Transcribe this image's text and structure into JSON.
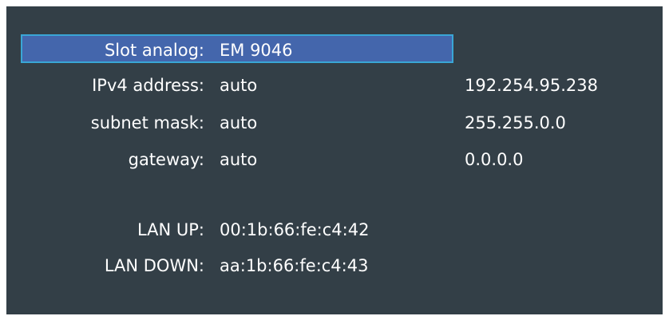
{
  "menu": {
    "slot": {
      "label": "Slot analog:",
      "value": "EM 9046"
    },
    "ipv4": {
      "label": "IPv4 address:",
      "value": "auto",
      "current": "192.254.95.238"
    },
    "subnet": {
      "label": "subnet mask:",
      "value": "auto",
      "current": "255.255.0.0"
    },
    "gateway": {
      "label": "gateway:",
      "value": "auto",
      "current": "0.0.0.0"
    },
    "lan_up": {
      "label": "LAN UP:",
      "value": "00:1b:66:fe:c4:42"
    },
    "lan_down": {
      "label": "LAN DOWN:",
      "value": "aa:1b:66:fe:c4:43"
    }
  },
  "colors": {
    "background": "#333f47",
    "selection_fill": "#4466ac",
    "selection_border": "#3aa6d6",
    "text": "#ffffff"
  }
}
